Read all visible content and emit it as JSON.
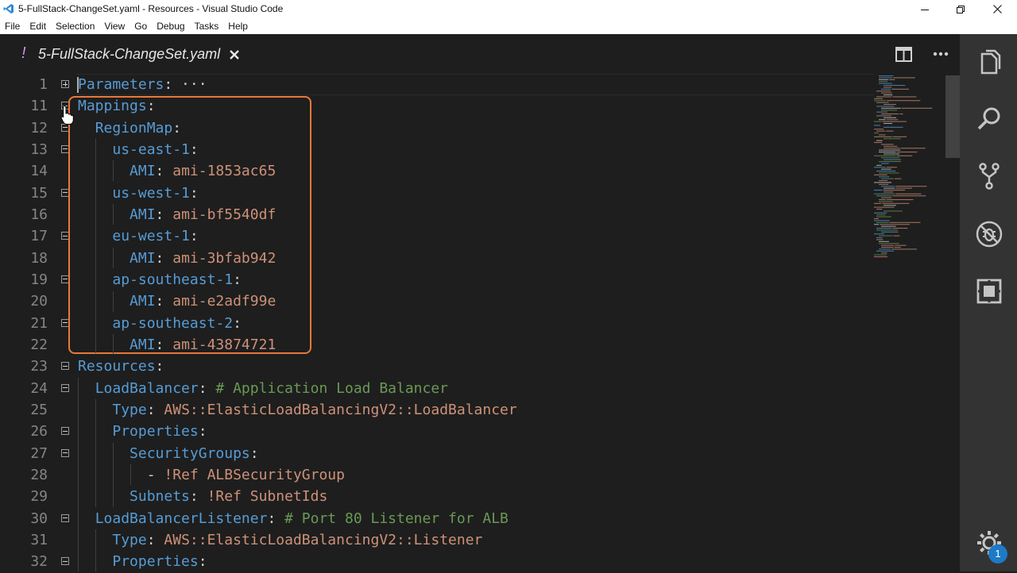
{
  "window": {
    "title": "5-FullStack-ChangeSet.yaml - Resources - Visual Studio Code"
  },
  "menu": [
    "File",
    "Edit",
    "Selection",
    "View",
    "Go",
    "Debug",
    "Tasks",
    "Help"
  ],
  "tab": {
    "modified_marker": "!",
    "filename": "5-FullStack-ChangeSet.yaml"
  },
  "activity": {
    "icons": [
      "explorer-icon",
      "search-icon",
      "source-control-icon",
      "debug-icon",
      "extensions-icon",
      "gear-icon"
    ],
    "badge_count": "1"
  },
  "editor": {
    "lines": [
      {
        "num": "1",
        "fold": "plus",
        "tokens": [
          {
            "t": "Parameters",
            "c": "k"
          },
          {
            "t": ":",
            "c": "p"
          },
          {
            "t": " ···",
            "c": "ell"
          }
        ]
      },
      {
        "num": "11",
        "fold": "minus",
        "tokens": [
          {
            "t": "Mappings",
            "c": "k"
          },
          {
            "t": ":",
            "c": "p"
          }
        ]
      },
      {
        "num": "12",
        "fold": "minus",
        "tokens": [
          {
            "t": "  ",
            "c": "p"
          },
          {
            "t": "RegionMap",
            "c": "k"
          },
          {
            "t": ":",
            "c": "p"
          }
        ]
      },
      {
        "num": "13",
        "fold": "minus",
        "tokens": [
          {
            "t": "    ",
            "c": "p"
          },
          {
            "t": "us-east-1",
            "c": "k"
          },
          {
            "t": ":",
            "c": "p"
          }
        ]
      },
      {
        "num": "14",
        "fold": "",
        "tokens": [
          {
            "t": "      ",
            "c": "p"
          },
          {
            "t": "AMI",
            "c": "k"
          },
          {
            "t": ": ",
            "c": "p"
          },
          {
            "t": "ami-1853ac65",
            "c": "s"
          }
        ]
      },
      {
        "num": "15",
        "fold": "minus",
        "tokens": [
          {
            "t": "    ",
            "c": "p"
          },
          {
            "t": "us-west-1",
            "c": "k"
          },
          {
            "t": ":",
            "c": "p"
          }
        ]
      },
      {
        "num": "16",
        "fold": "",
        "tokens": [
          {
            "t": "      ",
            "c": "p"
          },
          {
            "t": "AMI",
            "c": "k"
          },
          {
            "t": ": ",
            "c": "p"
          },
          {
            "t": "ami-bf5540df",
            "c": "s"
          }
        ]
      },
      {
        "num": "17",
        "fold": "minus",
        "tokens": [
          {
            "t": "    ",
            "c": "p"
          },
          {
            "t": "eu-west-1",
            "c": "k"
          },
          {
            "t": ":",
            "c": "p"
          }
        ]
      },
      {
        "num": "18",
        "fold": "",
        "tokens": [
          {
            "t": "      ",
            "c": "p"
          },
          {
            "t": "AMI",
            "c": "k"
          },
          {
            "t": ": ",
            "c": "p"
          },
          {
            "t": "ami-3bfab942",
            "c": "s"
          }
        ]
      },
      {
        "num": "19",
        "fold": "minus",
        "tokens": [
          {
            "t": "    ",
            "c": "p"
          },
          {
            "t": "ap-southeast-1",
            "c": "k"
          },
          {
            "t": ":",
            "c": "p"
          }
        ]
      },
      {
        "num": "20",
        "fold": "",
        "tokens": [
          {
            "t": "      ",
            "c": "p"
          },
          {
            "t": "AMI",
            "c": "k"
          },
          {
            "t": ": ",
            "c": "p"
          },
          {
            "t": "ami-e2adf99e",
            "c": "s"
          }
        ]
      },
      {
        "num": "21",
        "fold": "minus",
        "tokens": [
          {
            "t": "    ",
            "c": "p"
          },
          {
            "t": "ap-southeast-2",
            "c": "k"
          },
          {
            "t": ":",
            "c": "p"
          }
        ]
      },
      {
        "num": "22",
        "fold": "",
        "tokens": [
          {
            "t": "      ",
            "c": "p"
          },
          {
            "t": "AMI",
            "c": "k"
          },
          {
            "t": ": ",
            "c": "p"
          },
          {
            "t": "ami-43874721",
            "c": "s"
          }
        ]
      },
      {
        "num": "23",
        "fold": "minus",
        "tokens": [
          {
            "t": "Resources",
            "c": "k"
          },
          {
            "t": ":",
            "c": "p"
          }
        ]
      },
      {
        "num": "24",
        "fold": "minus",
        "tokens": [
          {
            "t": "  ",
            "c": "p"
          },
          {
            "t": "LoadBalancer",
            "c": "k"
          },
          {
            "t": ": ",
            "c": "p"
          },
          {
            "t": "# Application Load Balancer",
            "c": "c"
          }
        ]
      },
      {
        "num": "25",
        "fold": "",
        "tokens": [
          {
            "t": "    ",
            "c": "p"
          },
          {
            "t": "Type",
            "c": "k"
          },
          {
            "t": ": ",
            "c": "p"
          },
          {
            "t": "AWS::ElasticLoadBalancingV2::LoadBalancer",
            "c": "s"
          }
        ]
      },
      {
        "num": "26",
        "fold": "minus",
        "tokens": [
          {
            "t": "    ",
            "c": "p"
          },
          {
            "t": "Properties",
            "c": "k"
          },
          {
            "t": ":",
            "c": "p"
          }
        ]
      },
      {
        "num": "27",
        "fold": "minus",
        "tokens": [
          {
            "t": "      ",
            "c": "p"
          },
          {
            "t": "SecurityGroups",
            "c": "k"
          },
          {
            "t": ":",
            "c": "p"
          }
        ]
      },
      {
        "num": "28",
        "fold": "",
        "tokens": [
          {
            "t": "        ",
            "c": "p"
          },
          {
            "t": "- ",
            "c": "p"
          },
          {
            "t": "!Ref ALBSecurityGroup",
            "c": "s"
          }
        ]
      },
      {
        "num": "29",
        "fold": "",
        "tokens": [
          {
            "t": "      ",
            "c": "p"
          },
          {
            "t": "Subnets",
            "c": "k"
          },
          {
            "t": ": ",
            "c": "p"
          },
          {
            "t": "!Ref SubnetIds",
            "c": "s"
          }
        ]
      },
      {
        "num": "30",
        "fold": "minus",
        "tokens": [
          {
            "t": "  ",
            "c": "p"
          },
          {
            "t": "LoadBalancerListener",
            "c": "k"
          },
          {
            "t": ": ",
            "c": "p"
          },
          {
            "t": "# Port 80 Listener for ALB",
            "c": "c"
          }
        ]
      },
      {
        "num": "31",
        "fold": "",
        "tokens": [
          {
            "t": "    ",
            "c": "p"
          },
          {
            "t": "Type",
            "c": "k"
          },
          {
            "t": ": ",
            "c": "p"
          },
          {
            "t": "AWS::ElasticLoadBalancingV2::Listener",
            "c": "s"
          }
        ]
      },
      {
        "num": "32",
        "fold": "minus",
        "tokens": [
          {
            "t": "    ",
            "c": "p"
          },
          {
            "t": "Properties",
            "c": "k"
          },
          {
            "t": ":",
            "c": "p"
          }
        ]
      }
    ]
  }
}
